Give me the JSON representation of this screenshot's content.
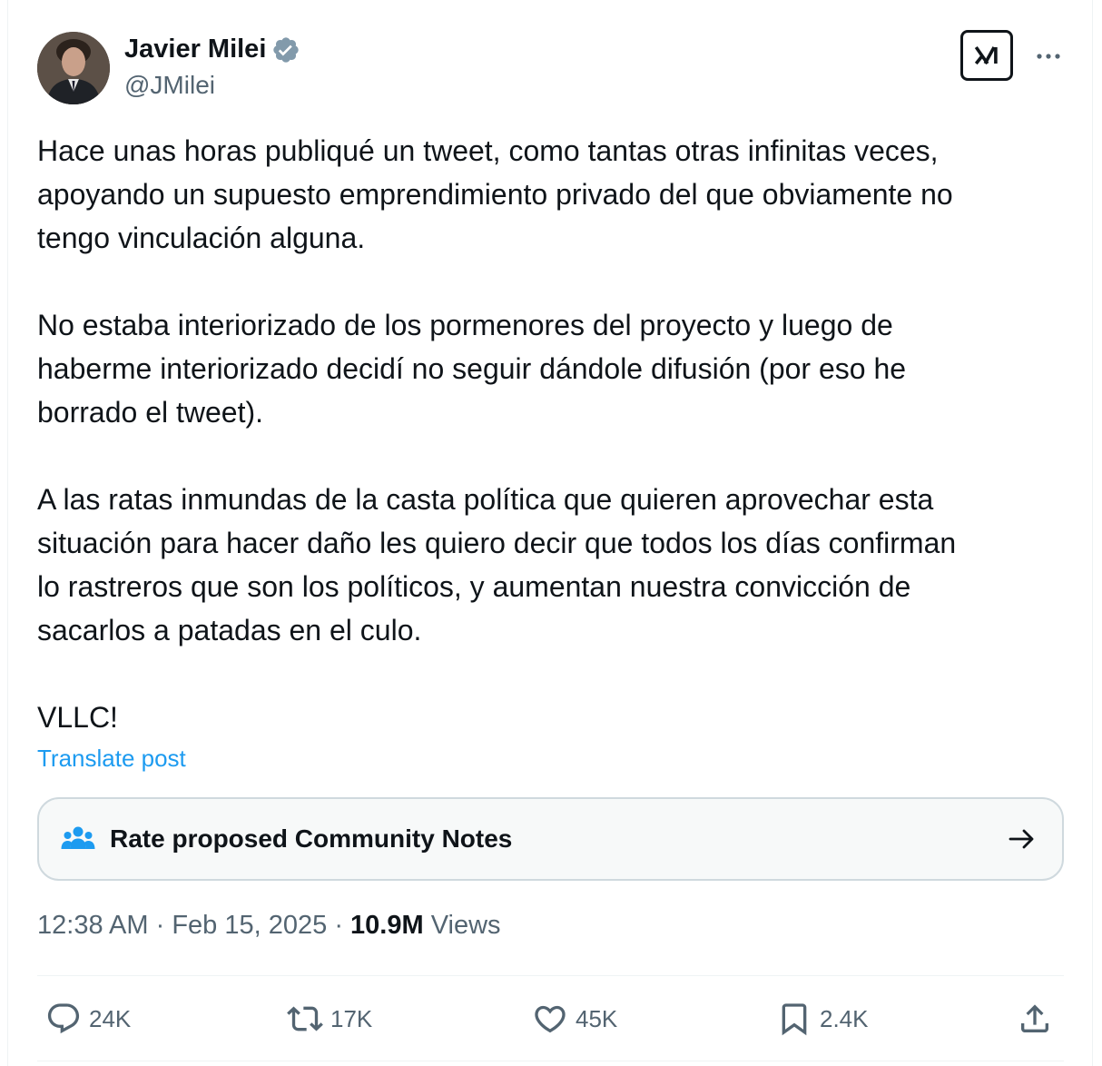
{
  "author": {
    "display_name": "Javier Milei",
    "handle": "@JMilei",
    "verified": true
  },
  "header_icons": {
    "grok": "grok-icon",
    "more": "more-icon"
  },
  "tweet": {
    "paragraphs": [
      {
        "lines": [
          "Hace unas horas publiqué un tweet, como tantas otras infinitas veces,",
          "apoyando un supuesto emprendimiento privado del que obviamente no",
          "tengo vinculación alguna."
        ]
      },
      {
        "lines": [
          "No estaba interiorizado de los pormenores del proyecto y luego de",
          "haberme interiorizado decidí no seguir dándole difusión (por eso he",
          "borrado el tweet)."
        ]
      },
      {
        "lines": [
          "A las ratas inmundas de la casta política que quieren aprovechar esta",
          "situación para hacer daño les quiero decir que todos los días confirman",
          "lo rastreros que son los políticos, y aumentan nuestra convicción de",
          "sacarlos a patadas en el culo."
        ]
      },
      {
        "lines": [
          "VLLC!"
        ]
      }
    ],
    "translate_label": "Translate post"
  },
  "community_notes": {
    "label": "Rate proposed Community Notes",
    "icon": "community-notes-icon",
    "arrow_icon": "arrow-right-icon"
  },
  "meta": {
    "time": "12:38 AM",
    "separator": "·",
    "date": "Feb 15, 2025",
    "views_count": "10.9M",
    "views_label": "Views"
  },
  "actions": {
    "reply": {
      "count": "24K",
      "icon": "reply-icon"
    },
    "retweet": {
      "count": "17K",
      "icon": "retweet-icon"
    },
    "like": {
      "count": "45K",
      "icon": "heart-icon"
    },
    "bookmark": {
      "count": "2.4K",
      "icon": "bookmark-icon"
    },
    "share": {
      "icon": "share-icon"
    }
  },
  "colors": {
    "text": "#0f1419",
    "secondary": "#536471",
    "link": "#1d9bf0",
    "verified": "#829aab",
    "border": "#cfd9de"
  }
}
